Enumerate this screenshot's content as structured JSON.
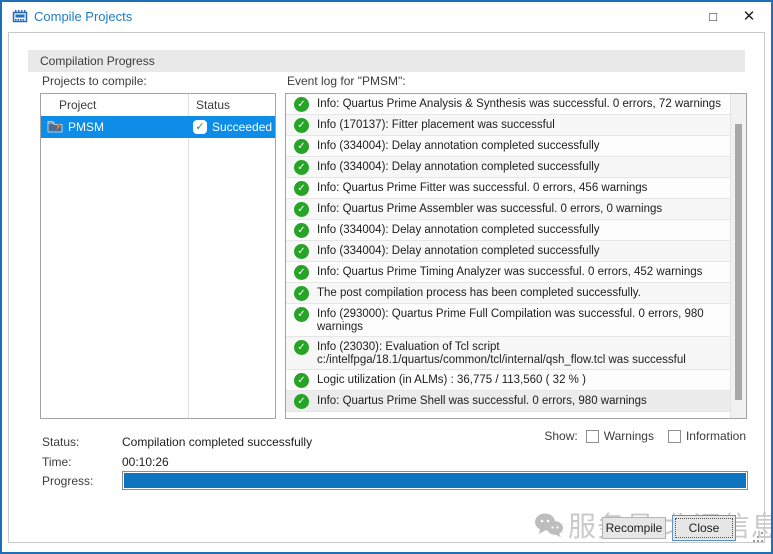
{
  "window": {
    "title": "Compile Projects",
    "maximize_glyph": "□",
    "close_glyph": "✕"
  },
  "section": {
    "header": "Compilation Progress"
  },
  "projects_panel": {
    "label": "Projects to compile:",
    "columns": [
      "Project",
      "Status"
    ],
    "rows": [
      {
        "project": "PMSM",
        "status": "Succeeded",
        "selected": true
      }
    ]
  },
  "event_log": {
    "label": "Event log for \"PMSM\":",
    "entries": [
      "Info: Quartus Prime Analysis & Synthesis was successful. 0 errors, 72 warnings",
      "Info (170137): Fitter placement was successful",
      "Info (334004): Delay annotation completed successfully",
      "Info (334004): Delay annotation completed successfully",
      "Info: Quartus Prime Fitter was successful. 0 errors, 456 warnings",
      "Info: Quartus Prime Assembler was successful. 0 errors, 0 warnings",
      "Info (334004): Delay annotation completed successfully",
      "Info (334004): Delay annotation completed successfully",
      "Info: Quartus Prime Timing Analyzer was successful. 0 errors, 452 warnings",
      "The post compilation process has been completed successfully.",
      "Info (293000): Quartus Prime Full Compilation was successful. 0 errors, 980 warnings",
      "Info (23030): Evaluation of Tcl script c:/intelfpga/18.1/quartus/common/tcl/internal/qsh_flow.tcl was successful",
      "Logic utilization (in ALMs) : 36,775 / 113,560 ( 32 % )",
      "Info: Quartus Prime Shell was successful. 0 errors, 980 warnings"
    ]
  },
  "footer": {
    "status_label": "Status:",
    "status_value": "Compilation completed successfully",
    "time_label": "Time:",
    "time_value": "00:10:26",
    "progress_label": "Progress:",
    "progress_percent": 100,
    "show_label": "Show:",
    "warnings_label": "Warnings",
    "information_label": "Information",
    "warnings_checked": false,
    "information_checked": false
  },
  "buttons": {
    "recompile": "Recompile",
    "close": "Close"
  },
  "watermark": {
    "text": "服务号 北汇信息"
  },
  "colors": {
    "window_border": "#1d6fb8",
    "title_text": "#1d7dc4",
    "selected_row": "#0d8ce8",
    "success_green": "#27a427",
    "progress_blue": "#0d75c0",
    "section_header_bg": "#e9e9e9"
  }
}
